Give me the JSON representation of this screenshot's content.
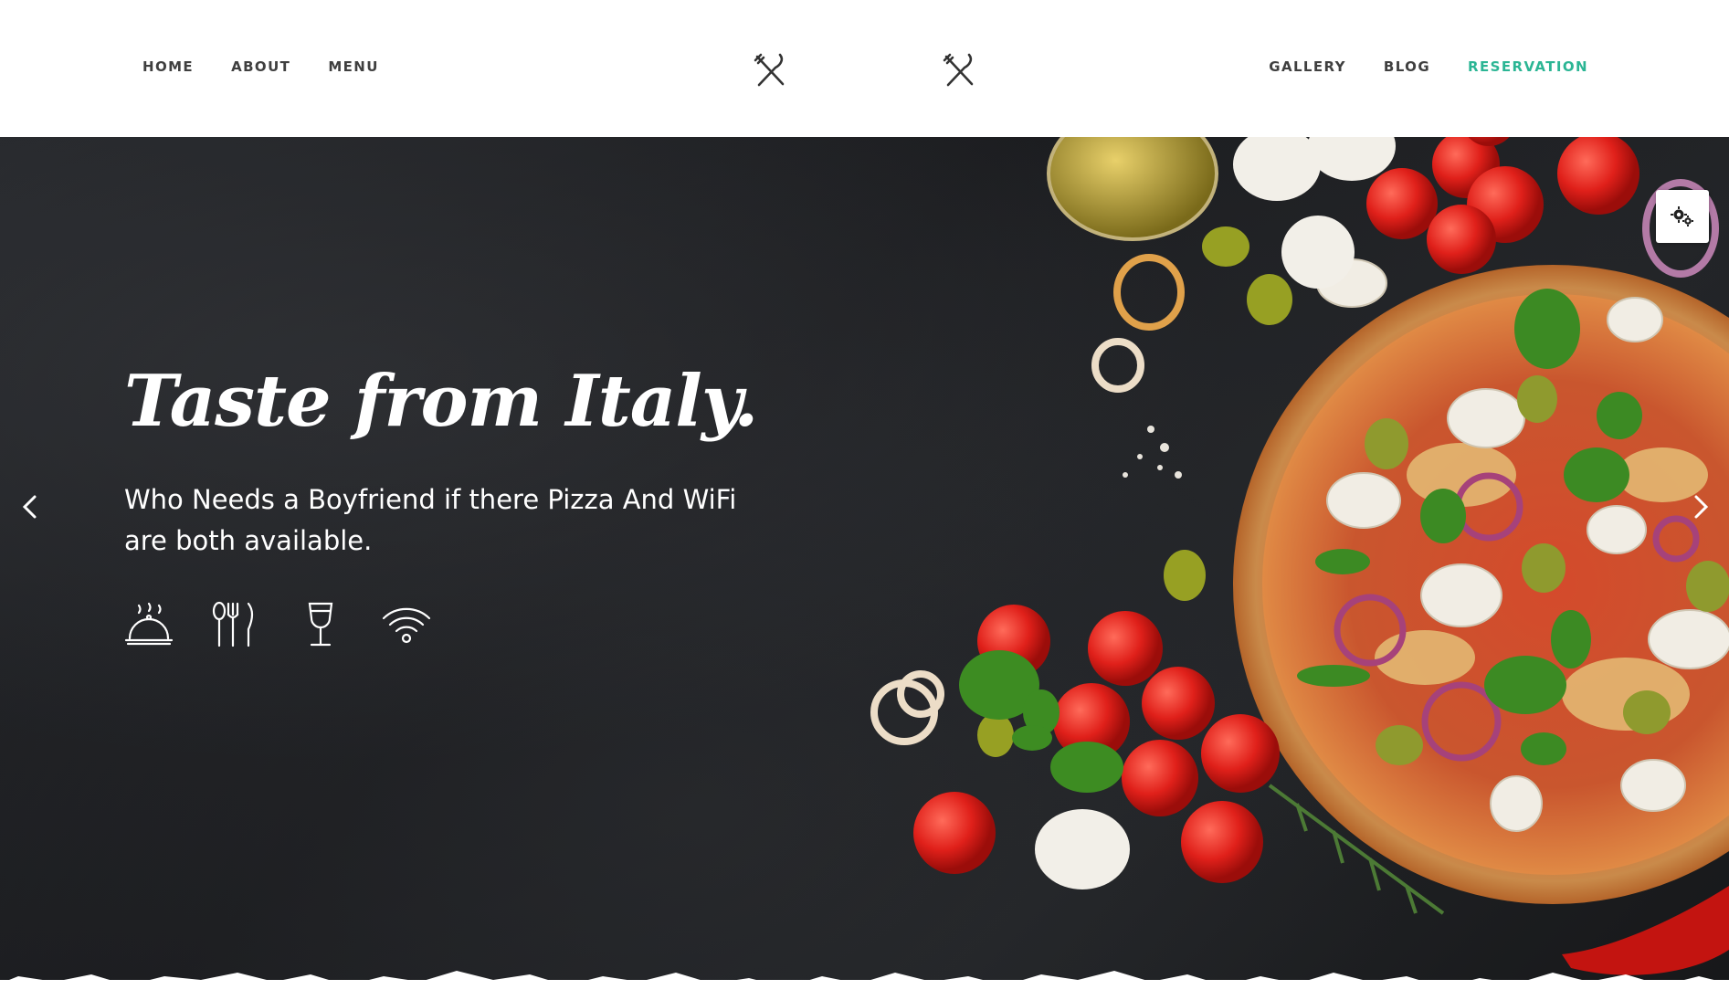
{
  "nav": {
    "left": [
      {
        "label": "HOME"
      },
      {
        "label": "ABOUT"
      },
      {
        "label": "MENU"
      }
    ],
    "right": [
      {
        "label": "GALLERY"
      },
      {
        "label": "BLOG"
      },
      {
        "label": "RESERVATION"
      }
    ]
  },
  "hero": {
    "title": "Taste from Italy.",
    "subtitle": "Who Needs a Boyfriend if there Pizza And WiFi are both available.",
    "amenities": [
      {
        "icon": "serving-cloche-icon"
      },
      {
        "icon": "cutlery-icon"
      },
      {
        "icon": "wine-glass-icon"
      },
      {
        "icon": "wifi-icon"
      }
    ]
  },
  "colors": {
    "accent": "#2bb594",
    "nav_text": "#3f3f3f",
    "hero_bg": "#1d1e21"
  },
  "icons": {
    "logo": "crossed-fork-knife-icon",
    "prev": "chevron-left-icon",
    "next": "chevron-right-icon",
    "settings": "gears-icon"
  }
}
